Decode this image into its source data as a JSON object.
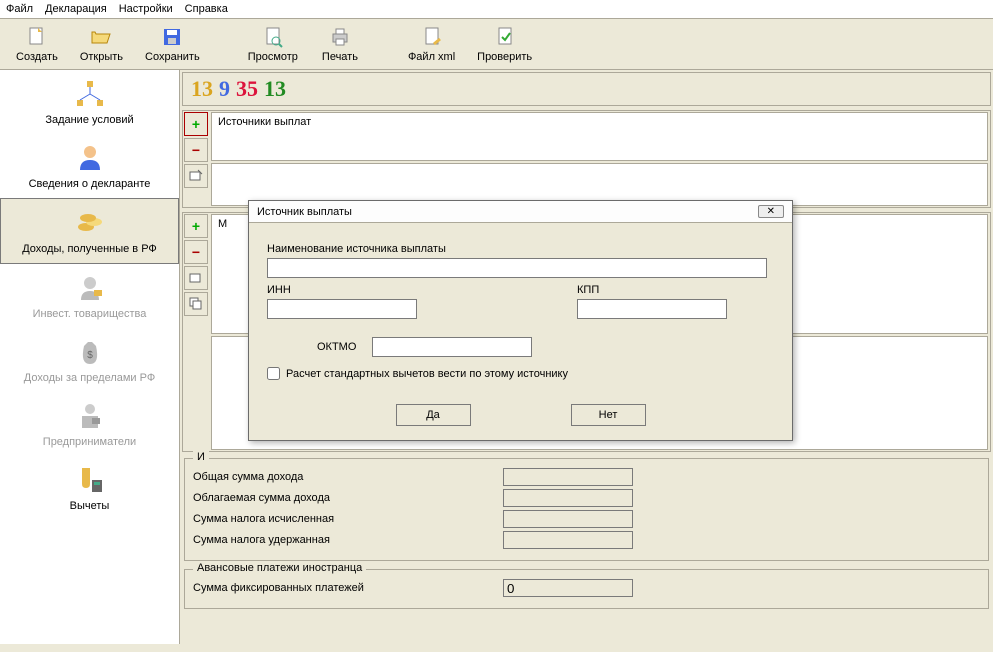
{
  "menu": {
    "file": "Файл",
    "decl": "Декларация",
    "settings": "Настройки",
    "help": "Справка"
  },
  "toolbar": {
    "create": "Создать",
    "open": "Открыть",
    "save": "Сохранить",
    "preview": "Просмотр",
    "print": "Печать",
    "xml": "Файл xml",
    "check": "Проверить"
  },
  "sidebar": {
    "conditions": "Задание условий",
    "declarant": "Сведения о декларанте",
    "income_rf": "Доходы, полученные в РФ",
    "invest": "Инвест. товарищества",
    "income_abroad": "Доходы за пределами РФ",
    "entrepreneurs": "Предприниматели",
    "deductions": "Вычеты"
  },
  "numbar": {
    "a": "13",
    "b": "9",
    "c": "35",
    "d": "13"
  },
  "panels": {
    "sources_header": "Источники выплат",
    "months_partial": "М"
  },
  "totals": {
    "group_title": "И",
    "total_income": "Общая сумма дохода",
    "taxable_income": "Облагаемая сумма дохода",
    "tax_calculated": "Сумма налога исчисленная",
    "tax_withheld": "Сумма налога удержанная"
  },
  "advance": {
    "group_title": "Авансовые платежи иностранца",
    "fixed_sum": "Сумма фиксированных платежей",
    "fixed_val": "0"
  },
  "dialog": {
    "title": "Источник выплаты",
    "name_label": "Наименование источника выплаты",
    "inn": "ИНН",
    "kpp": "КПП",
    "oktmo": "ОКТМО",
    "calc_checkbox": "Расчет стандартных вычетов вести по этому источнику",
    "yes": "Да",
    "no": "Нет"
  }
}
